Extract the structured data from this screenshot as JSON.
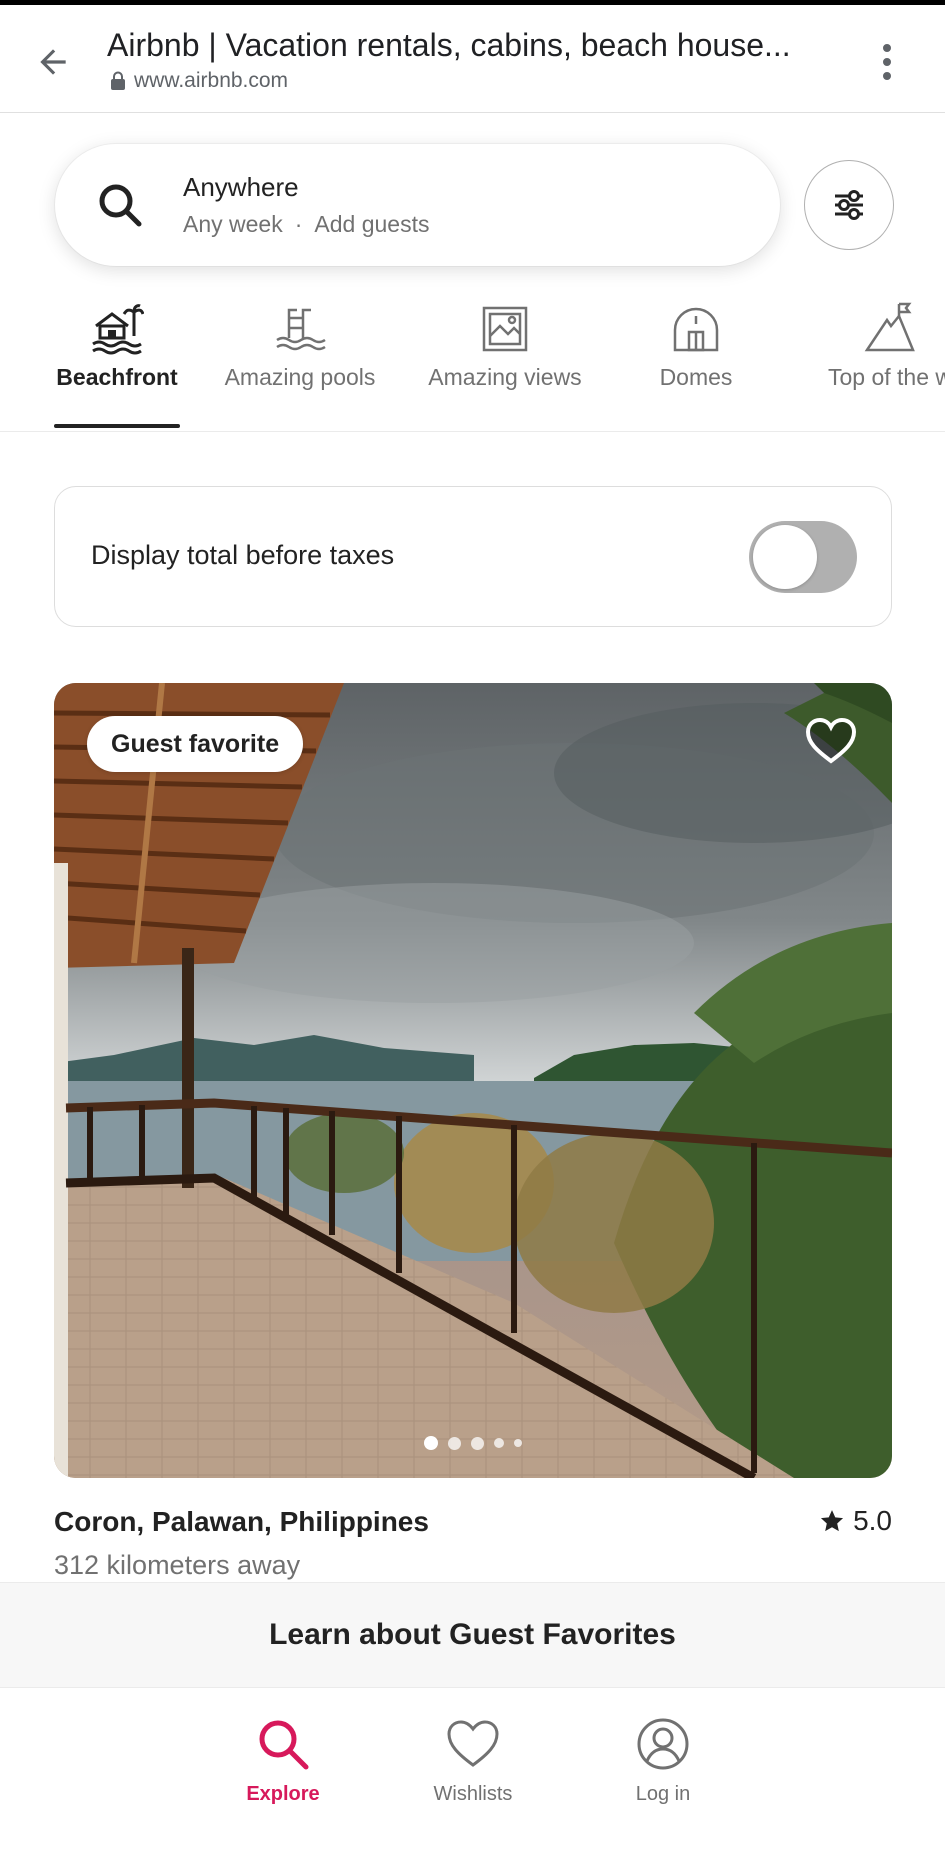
{
  "browser": {
    "title": "Airbnb | Vacation rentals, cabins, beach house...",
    "url": "www.airbnb.com"
  },
  "search": {
    "primary": "Anywhere",
    "when": "Any week",
    "separator": "·",
    "guests": "Add guests"
  },
  "categories": [
    {
      "label": "Beachfront",
      "icon": "beach-house-icon",
      "active": true
    },
    {
      "label": "Amazing pools",
      "icon": "pool-icon",
      "active": false
    },
    {
      "label": "Amazing views",
      "icon": "views-icon",
      "active": false
    },
    {
      "label": "Domes",
      "icon": "dome-icon",
      "active": false
    },
    {
      "label": "Top of the w",
      "icon": "mountain-flag-icon",
      "active": false
    }
  ],
  "taxes": {
    "label": "Display total before taxes",
    "toggle_on": false
  },
  "listing": {
    "badge": "Guest favorite",
    "location": "Coron, Palawan, Philippines",
    "distance": "312 kilometers away",
    "rating": "5.0",
    "photo_count": 5,
    "current_photo": 1
  },
  "learn_more": "Learn about Guest Favorites",
  "nav": {
    "explore": "Explore",
    "wishlists": "Wishlists",
    "login": "Log in"
  },
  "colors": {
    "brand": "#d7195b",
    "text": "#222222",
    "muted": "#717171"
  }
}
